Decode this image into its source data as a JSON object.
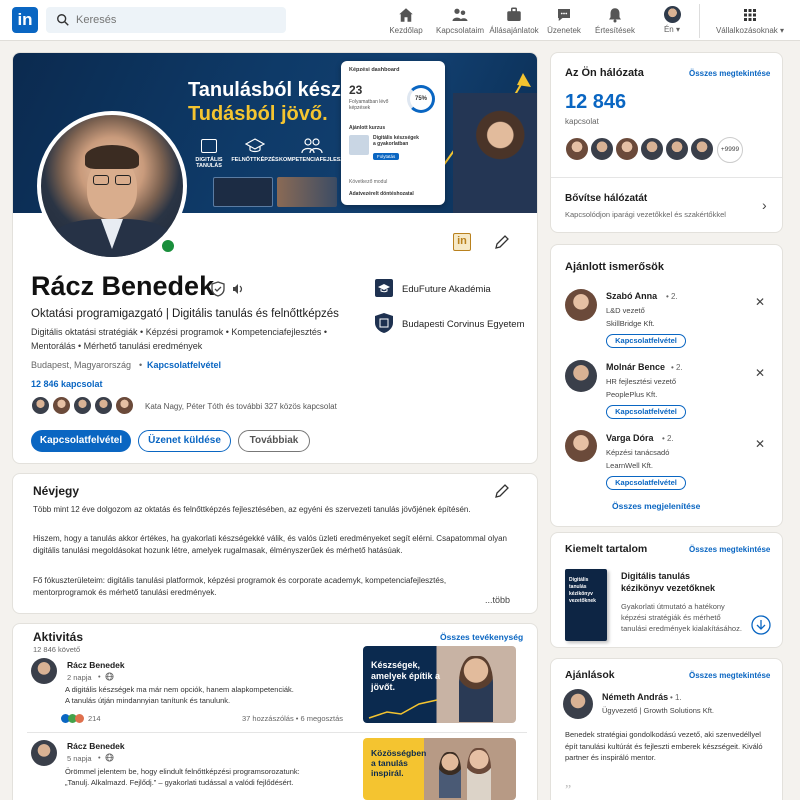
{
  "nav": {
    "search_placeholder": "Keresés",
    "items": [
      {
        "label": "Kezdőlap",
        "icon": "home-icon"
      },
      {
        "label": "Kapcsolataim",
        "icon": "network-icon"
      },
      {
        "label": "Állásajánlatok",
        "icon": "briefcase-icon"
      },
      {
        "label": "Üzenetek",
        "icon": "chat-icon"
      },
      {
        "label": "Értesítések",
        "icon": "bell-icon"
      },
      {
        "label": "Én",
        "icon": "avatar"
      },
      {
        "label": "Vállalkozásoknak",
        "icon": "grid-icon"
      }
    ],
    "accent": "#0a66c2"
  },
  "banner": {
    "line1": "Tanulásból készség.",
    "line2": "Tudásból jövő.",
    "icons": [
      "DIGITÁLIS TANULÁS",
      "FELNŐTTKÉPZÉS",
      "KOMPETENCIAFEJLESZTÉS"
    ],
    "dashboard": {
      "title": "Képzési dashboard",
      "stat_value": "23",
      "stat_label": "Folyamatban lévő képzések",
      "progress": "75%",
      "section": "Ajánlott kurzus",
      "course_title": "Digitális készségek a gyakorlatban",
      "course_action": "Folytatás",
      "next_module": "Következő modul",
      "next_module_name": "Adatvezérelt döntéshozatal"
    }
  },
  "profile": {
    "name": "Rácz Benedek",
    "headline": "Oktatási programigazgató | Digitális tanulás és felnőttképzés",
    "skills_line1": "Digitális oktatási stratégiák • Képzési programok • Kompetenciafejlesztés •",
    "skills_line2": "Mentorálás • Mérhető tanulási eredmények",
    "location": "Budapest, Magyarország",
    "contact_link": "Kapcsolatfelvétel",
    "connections": "12 846 kapcsolat",
    "mutual": "Kata Nagy, Péter Tóth és további 327 közös kapcsolat",
    "btn_connect": "Kapcsolatfelvétel",
    "btn_message": "Üzenet küldése",
    "btn_more": "Továbbiak",
    "company": "EduFuture Akadémia",
    "school": "Budapesti Corvinus Egyetem",
    "logo_badge": "in"
  },
  "about": {
    "title": "Névjegy",
    "p1": "Több mint 12 éve dolgozom az oktatás és felnőttképzés fejlesztésében, az egyéni és szervezeti tanulás jövőjének építésén.",
    "p2": "Hiszem, hogy a tanulás akkor értékes, ha gyakorlati készségekké válik, és valós üzleti eredményeket segít elérni. Csapatommal olyan digitális tanulási megoldásokat hozunk létre, amelyek rugalmasak, élményszerűek és mérhető hatásúak.",
    "p3": "Fő fókuszterületeim: digitális tanulási platformok, képzési programok és corporate academyk, kompetenciafejlesztés, mentorprogramok és mérhető tanulási eredmények.",
    "more": "...több"
  },
  "activity": {
    "title": "Aktivitás",
    "followers": "12 846 követő",
    "see_all": "Összes tevékenység",
    "posts": [
      {
        "author": "Rácz Benedek",
        "time": "2 napja",
        "text1": "A digitális készségek ma már nem opciók, hanem alapkompetenciák.",
        "text2": "A tanulás útján mindannyian tanítunk és tanulunk.",
        "reactions": "214",
        "comments": "37 hozzászólás • 6 megosztás",
        "image_text": "Készségek, amelyek építik a jövőt."
      },
      {
        "author": "Rácz Benedek",
        "time": "5 napja",
        "text1": "Örömmel jelentem be, hogy elindult felnőttképzési programsorozatunk:",
        "text2": "„Tanulj. Alkalmazd. Fejlődj.” – gyakorlati tudással a valódi fejlődésért.",
        "image_text": "Közösségben a tanulás inspirál."
      }
    ]
  },
  "network": {
    "title": "Az Ön hálózata",
    "see_all": "Összes megtekintése",
    "count": "12 846",
    "count_label": "kapcsolat",
    "extra": "+9999",
    "grow_title": "Bővítse hálózatát",
    "grow_text": "Kapcsolódjon iparági vezetőkkel és szakértőkkel"
  },
  "suggested": {
    "title": "Ajánlott ismerősök",
    "btn": "Kapcsolatfelvétel",
    "show_all": "Összes megjelenítése",
    "people": [
      {
        "name": "Szabó Anna",
        "degree": "• 2.",
        "role": "L&D vezető",
        "company": "SkillBridge Kft."
      },
      {
        "name": "Molnár Bence",
        "degree": "• 2.",
        "role": "HR fejlesztési vezető",
        "company": "PeoplePlus Kft."
      },
      {
        "name": "Varga Dóra",
        "degree": "• 2.",
        "role": "Képzési tanácsadó",
        "company": "LearnWell Kft."
      }
    ]
  },
  "featured": {
    "title": "Kiemelt tartalom",
    "see_all": "Összes megtekintése",
    "book_cover": "Digitális tanulás kézikönyv vezetőknek",
    "item_title1": "Digitális tanulás",
    "item_title2": "kézikönyv vezetőknek",
    "desc": "Gyakorlati útmutató a hatékony képzési stratégiák és mérhető tanulási eredmények kialakításához."
  },
  "recommendations": {
    "title": "Ajánlások",
    "see_all": "Összes megtekintése",
    "name": "Németh András",
    "degree": "• 1.",
    "role": "Ügyvezető | Growth Solutions Kft.",
    "text": "Benedek stratégiai gondolkodású vezető, aki szenvedéllyel épít tanulási kultúrát és fejleszti emberek készségeit. Kiváló partner és inspiráló mentor."
  }
}
